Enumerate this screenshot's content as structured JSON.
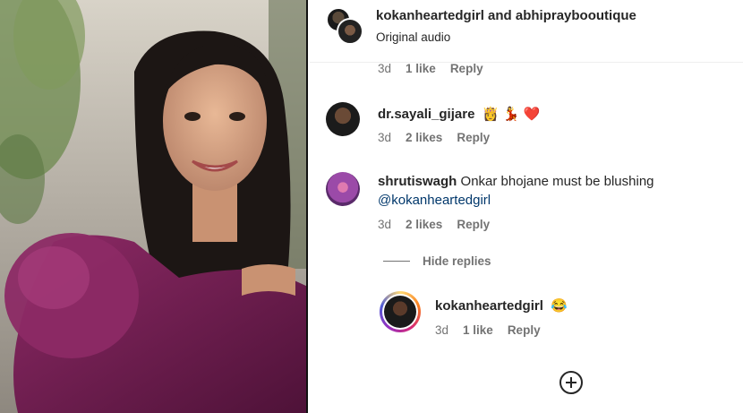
{
  "header": {
    "title": "kokanheartedgirl and abhipraybooutique",
    "subtitle": "Original audio",
    "meta": {
      "time": "3d",
      "likes": "1 like",
      "reply": "Reply"
    }
  },
  "comments": [
    {
      "username": "dr.sayali_gijare",
      "text": "👸 💃 ❤️",
      "time": "3d",
      "likes": "2 likes",
      "reply": "Reply"
    },
    {
      "username": "shrutiswagh",
      "text": "Onkar bhojane must be blushing",
      "mention": "@kokanheartedgirl",
      "time": "3d",
      "likes": "2 likes",
      "reply": "Reply",
      "hide_replies": "Hide replies",
      "replies": [
        {
          "username": "kokanheartedgirl",
          "text": "😂",
          "time": "3d",
          "likes": "1 like",
          "reply": "Reply"
        }
      ]
    }
  ],
  "icons": {
    "add": "plus-circle-icon"
  },
  "colors": {
    "accent_link": "#00376b",
    "muted": "#737373",
    "story_ring": [
      "#feda75",
      "#d62976",
      "#962fbf"
    ]
  }
}
